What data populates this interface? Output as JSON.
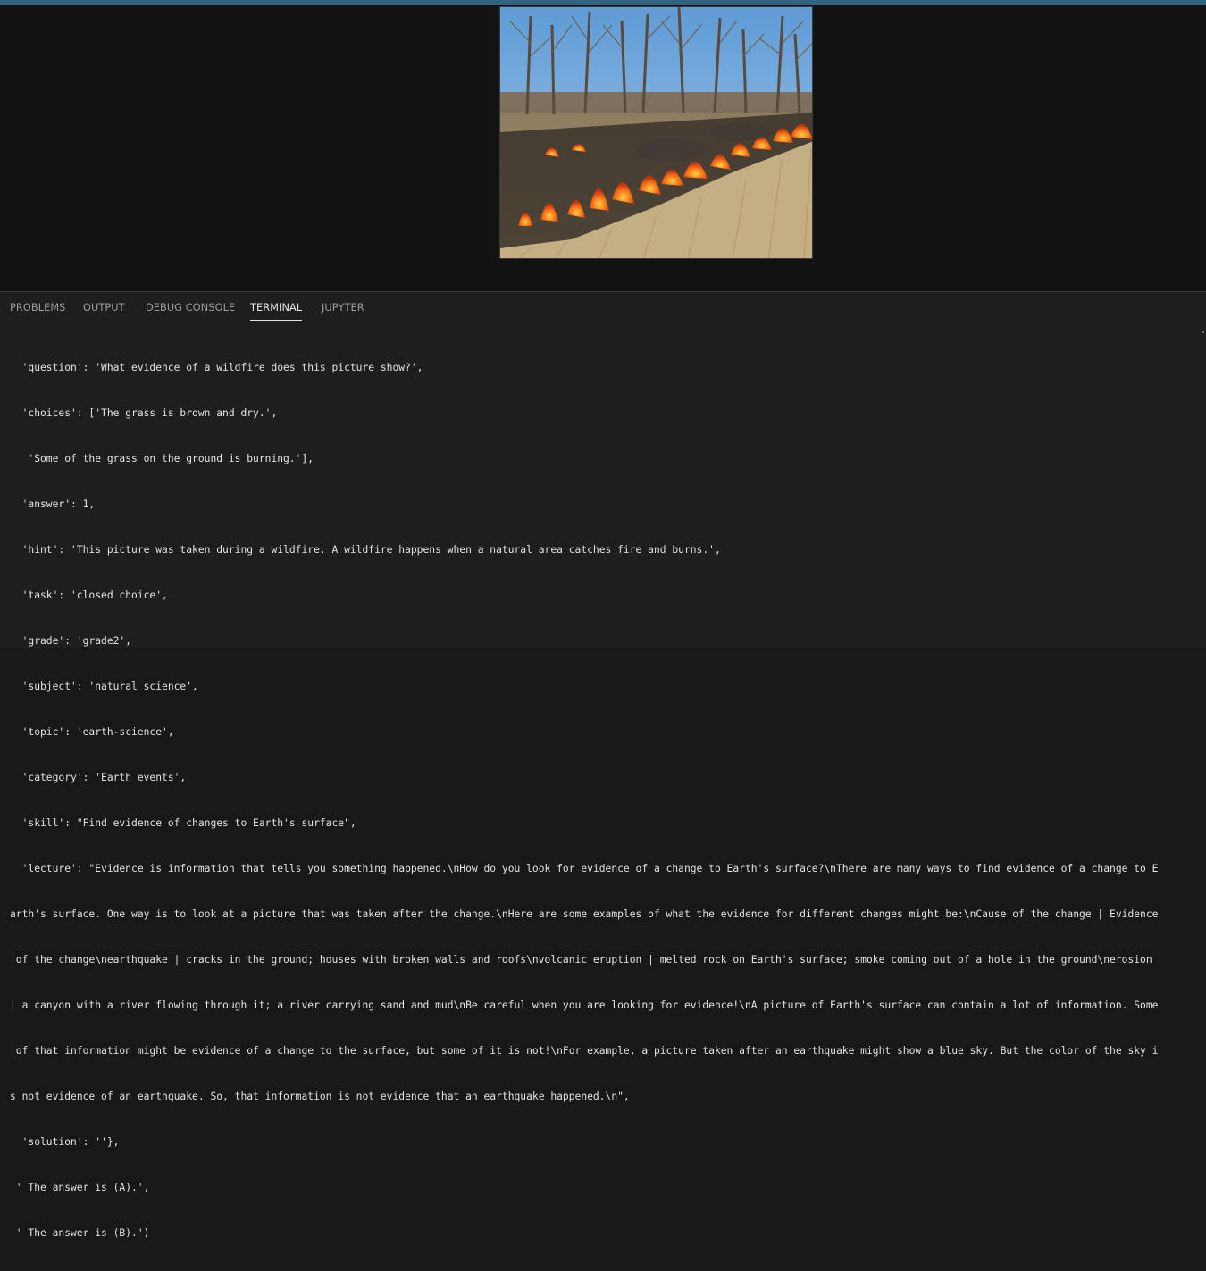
{
  "output": {
    "image_icon": "wildfire-photo"
  },
  "panel": {
    "tabs": [
      {
        "label": "PROBLEMS"
      },
      {
        "label": "OUTPUT"
      },
      {
        "label": "DEBUG CONSOLE"
      },
      {
        "label": "TERMINAL",
        "active": true
      },
      {
        "label": "JUPYTER"
      }
    ]
  },
  "terminal": {
    "lines": [
      "  'question': 'What evidence of a wildfire does this picture show?',",
      "  'choices': ['The grass is brown and dry.',",
      "   'Some of the grass on the ground is burning.'],",
      "  'answer': 1,",
      "  'hint': 'This picture was taken during a wildfire. A wildfire happens when a natural area catches fire and burns.',",
      "  'task': 'closed choice',",
      "  'grade': 'grade2',",
      "  'subject': 'natural science',",
      "  'topic': 'earth-science',",
      "  'category': 'Earth events',",
      "  'skill': \"Find evidence of changes to Earth's surface\",",
      "  'lecture': \"Evidence is information that tells you something happened.\\nHow do you look for evidence of a change to Earth's surface?\\nThere are many ways to find evidence of a change to E",
      "arth's surface. One way is to look at a picture that was taken after the change.\\nHere are some examples of what the evidence for different changes might be:\\nCause of the change | Evidence",
      " of the change\\nearthquake | cracks in the ground; houses with broken walls and roofs\\nvolcanic eruption | melted rock on Earth's surface; smoke coming out of a hole in the ground\\nerosion",
      "| a canyon with a river flowing through it; a river carrying sand and mud\\nBe careful when you are looking for evidence!\\nA picture of Earth's surface can contain a lot of information. Some",
      " of that information might be evidence of a change to the surface, but some of it is not!\\nFor example, a picture taken after an earthquake might show a blue sky. But the color of the sky i",
      "s not evidence of an earthquake. So, that information is not evidence that an earthquake happened.\\n\",",
      "  'solution': ''},",
      " ' The answer is (A).',",
      " ' The answer is (B).')"
    ]
  }
}
